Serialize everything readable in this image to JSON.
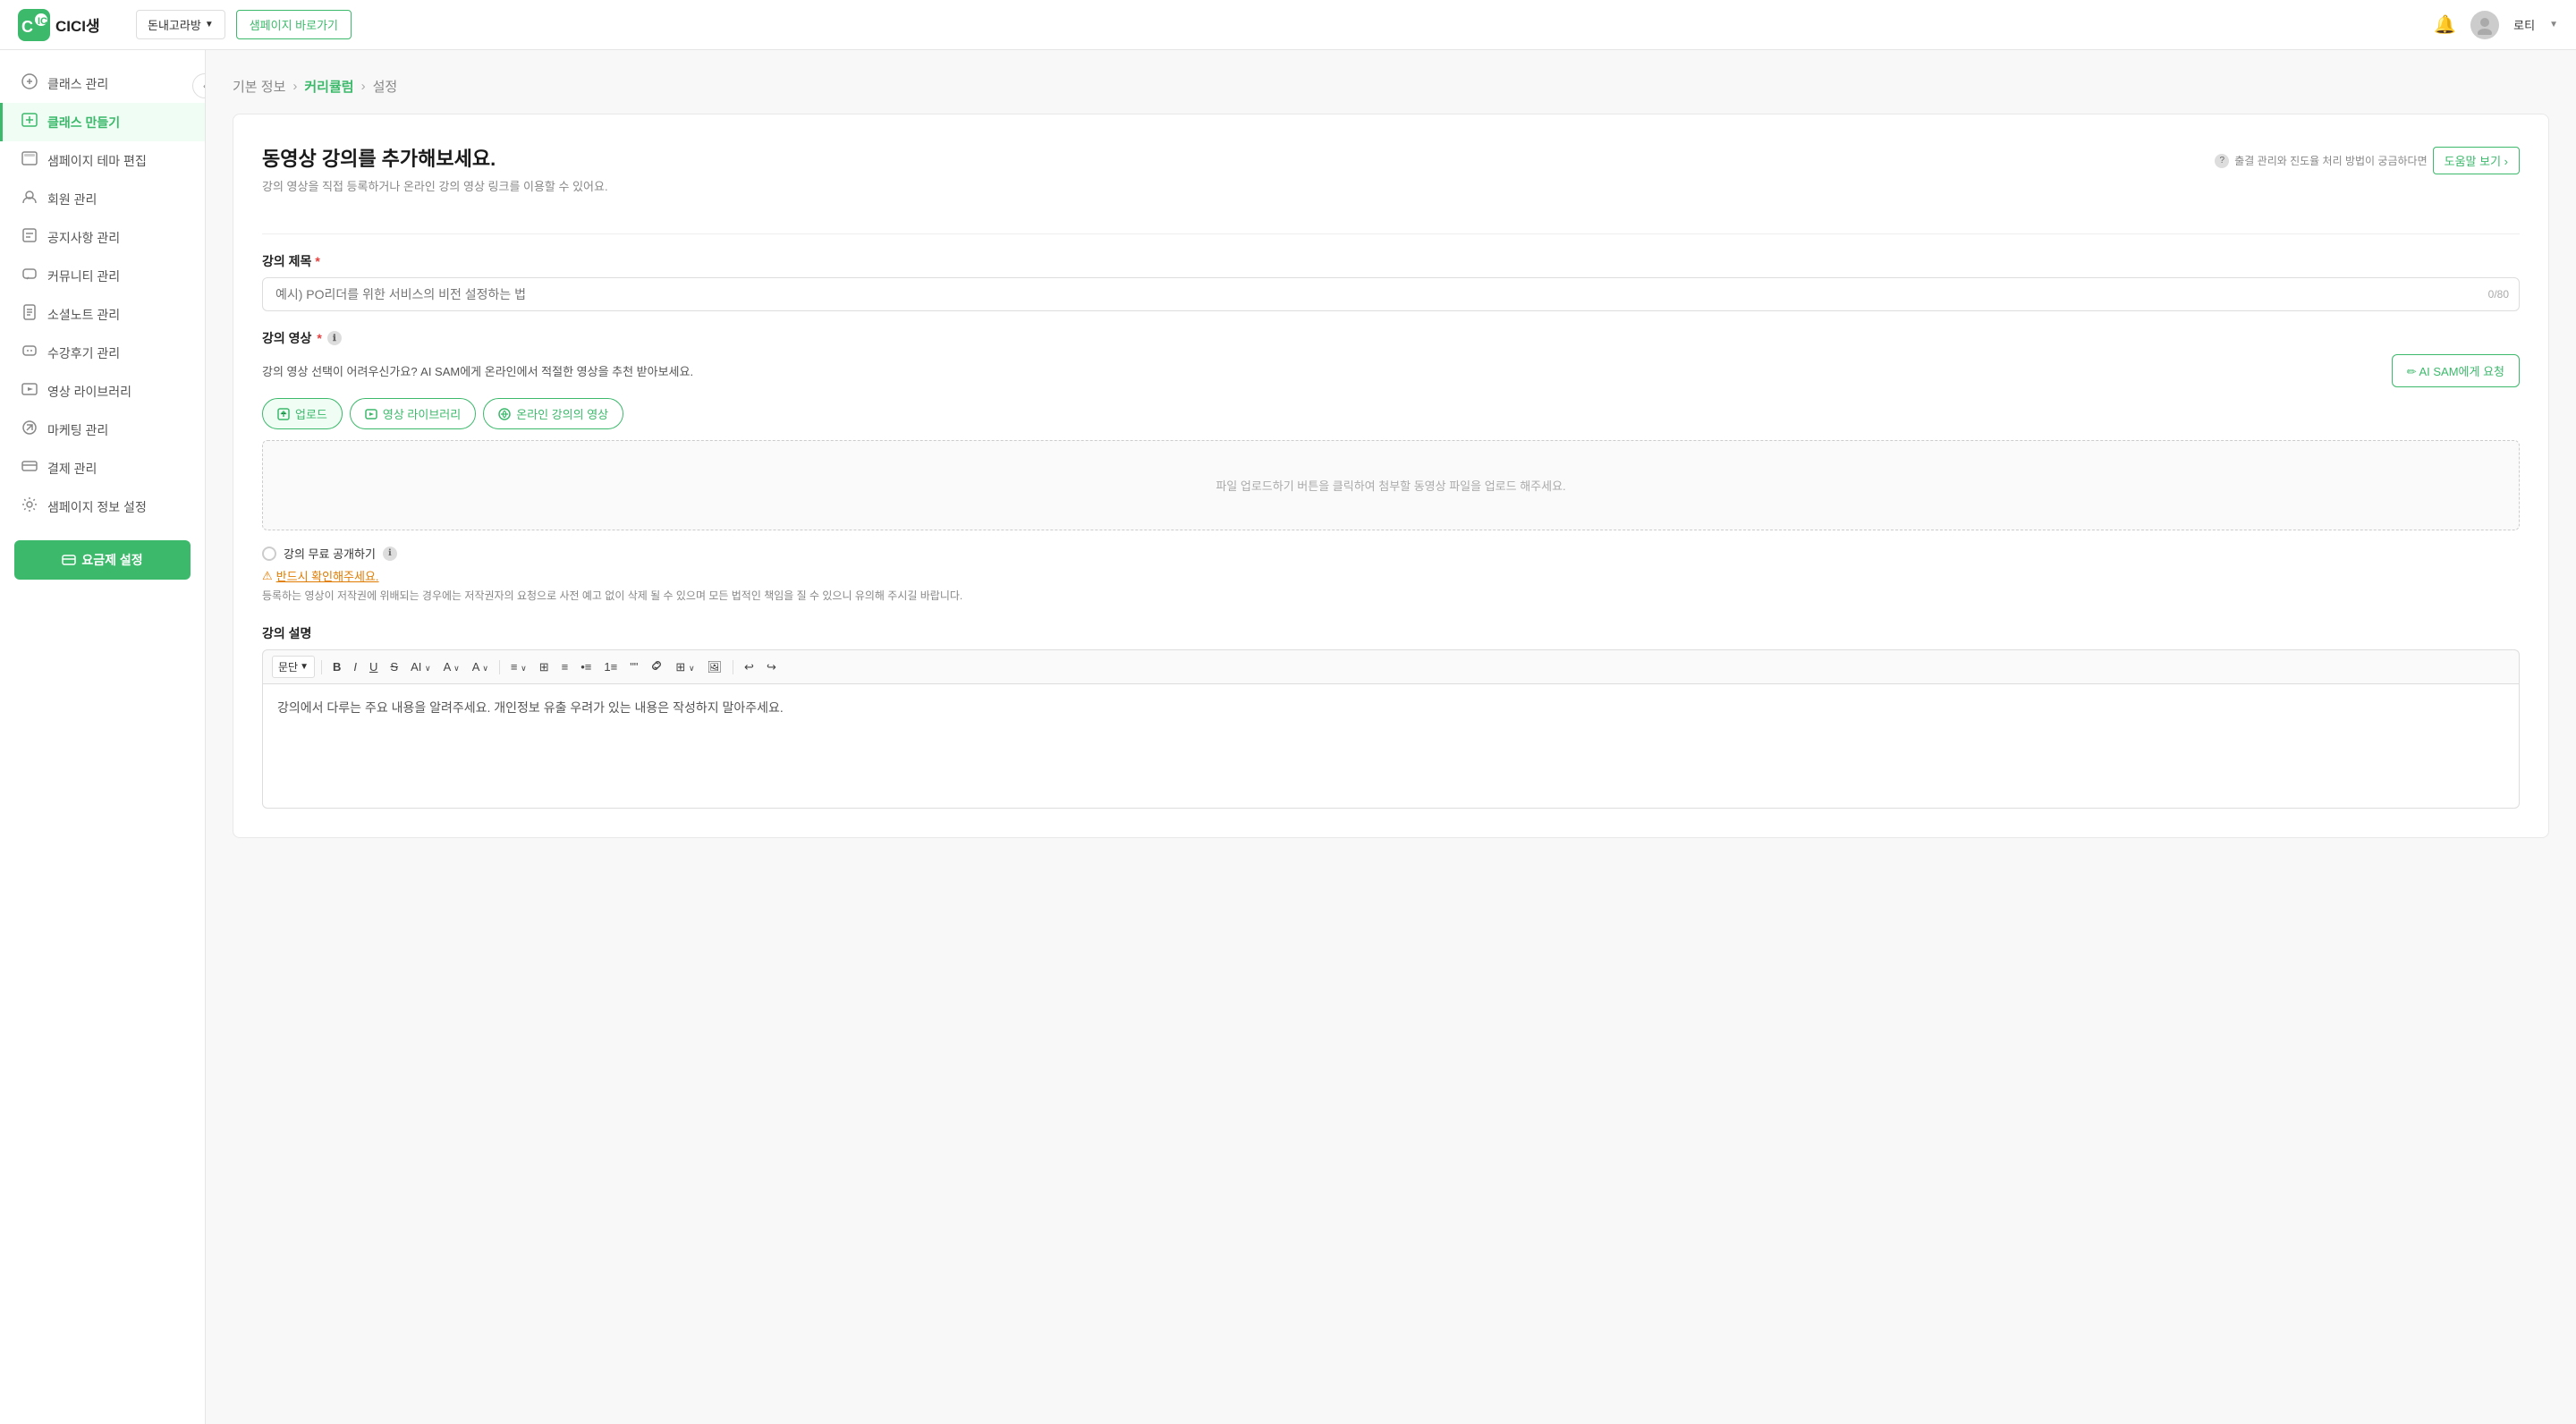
{
  "header": {
    "logo_alt": "CICI생",
    "nav_dropdown": "돈내고라방",
    "nav_btn": "샘페이지 바로가기",
    "user_name": "로티",
    "bell_icon": "🔔",
    "avatar_icon": "👤"
  },
  "sidebar": {
    "collapse_icon": "‹",
    "items": [
      {
        "id": "class-manage",
        "label": "클래스 관리",
        "icon": "🎓",
        "active": false
      },
      {
        "id": "class-create",
        "label": "클래스 만들기",
        "icon": "📋",
        "active": true
      },
      {
        "id": "page-theme",
        "label": "샘페이지 테마 편집",
        "icon": "🖥️",
        "active": false
      },
      {
        "id": "member-manage",
        "label": "회원 관리",
        "icon": "👤",
        "active": false
      },
      {
        "id": "notice-manage",
        "label": "공지사항 관리",
        "icon": "📄",
        "active": false
      },
      {
        "id": "community-manage",
        "label": "커뮤니티 관리",
        "icon": "💬",
        "active": false
      },
      {
        "id": "note-manage",
        "label": "소셜노트 관리",
        "icon": "📝",
        "active": false
      },
      {
        "id": "feedback-manage",
        "label": "수강후기 관리",
        "icon": "💭",
        "active": false
      },
      {
        "id": "video-library",
        "label": "영상 라이브러리",
        "icon": "🎬",
        "active": false
      },
      {
        "id": "marketing-manage",
        "label": "마케팅 관리",
        "icon": "🛍️",
        "active": false
      },
      {
        "id": "payment-manage",
        "label": "결제 관리",
        "icon": "💳",
        "active": false
      },
      {
        "id": "page-settings",
        "label": "샘페이지 정보 설정",
        "icon": "⚙️",
        "active": false
      }
    ],
    "bottom_btn": "요금제 설정"
  },
  "breadcrumb": {
    "items": [
      {
        "label": "기본 정보",
        "active": false
      },
      {
        "label": "커리큘럼",
        "active": true
      },
      {
        "label": "설정",
        "active": false
      }
    ]
  },
  "main": {
    "title": "동영상 강의를 추가해보세요.",
    "subtitle": "강의 영상을 직접 등록하거나 온라인 강의 영상 링크를 이용할 수 있어요.",
    "help_hint": "출결 관리와 진도율 처리 방법이 궁금하다면",
    "help_btn": "도움말 보기 ›",
    "lecture_title": {
      "label": "강의 제목",
      "required": true,
      "placeholder": "예시) PO리더를 위한 서비스의 비전 설정하는 법",
      "char_count": "0/80"
    },
    "lecture_video": {
      "label": "강의 영상",
      "required": true,
      "info_icon": "ℹ",
      "ai_hint": "강의 영상 선택이 어려우신가요? AI SAM에게 온라인에서 적절한 영상을 추천 받아보세요.",
      "ai_btn": "✏ AI SAM에게 요청",
      "tabs": [
        {
          "id": "upload",
          "label": "업로드",
          "icon": "📄",
          "active": true
        },
        {
          "id": "library",
          "label": "영상 라이브러리",
          "icon": "🎬",
          "active": false
        },
        {
          "id": "online",
          "label": "온라인 강의의 영상",
          "icon": "🔗",
          "active": false
        }
      ],
      "upload_placeholder": "파일 업로드하기 버튼을 클릭하여 첨부할 동영상 파일을 업로드 해주세요."
    },
    "free_toggle": {
      "label": "강의 무료 공개하기",
      "info_icon": "ℹ"
    },
    "warning": {
      "icon": "⚠",
      "text": "반드시 확인해주세요.",
      "copyright": "등록하는 영상이 저작권에 위배되는 경우에는 저작권자의 요청으로 사전 예고 없이 삭제 될 수 있으며 모든 법적인 책임을 질 수 있으니 유의해 주시길 바랍니다."
    },
    "description": {
      "label": "강의 설명",
      "toolbar": {
        "style_dropdown": "문단",
        "buttons": [
          "B",
          "I",
          "U",
          "S",
          "AI∨",
          "A∨",
          "A∨",
          "|",
          "≡∨",
          "⊞",
          "≡",
          "•≡",
          "•≡",
          "\"\"",
          "🔗",
          "⊞∨",
          "🖼",
          "|",
          "↩",
          "↪"
        ]
      },
      "placeholder": "강의에서 다루는 주요 내용을 알려주세요. 개인정보 유출 우려가 있는 내용은 작성하지 말아주세요."
    }
  }
}
